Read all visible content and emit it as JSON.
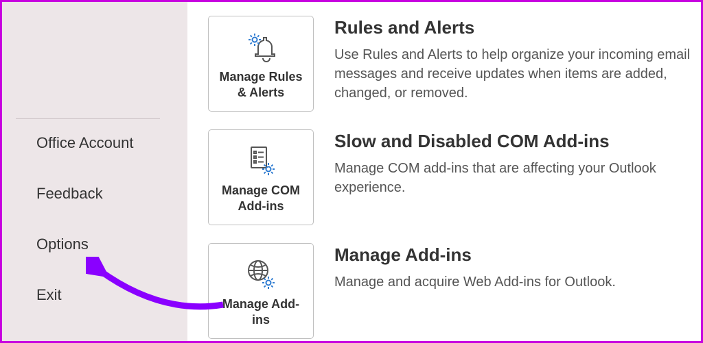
{
  "sidebar": {
    "items": [
      {
        "label": "Office Account"
      },
      {
        "label": "Feedback"
      },
      {
        "label": "Options"
      },
      {
        "label": "Exit"
      }
    ]
  },
  "main": {
    "rows": [
      {
        "tile_label": "Manage Rules & Alerts",
        "title": "Rules and Alerts",
        "text": "Use Rules and Alerts to help organize your incoming email messages and receive updates when items are added, changed, or removed."
      },
      {
        "tile_label": "Manage COM Add-ins",
        "title": "Slow and Disabled COM Add-ins",
        "text": "Manage COM add-ins that are affecting your Outlook experience."
      },
      {
        "tile_label": "Manage Add-ins",
        "title": "Manage Add-ins",
        "text": "Manage and acquire Web Add-ins for Outlook."
      }
    ]
  },
  "colors": {
    "accent": "#2e7bd1",
    "annotation": "#8a00ff"
  }
}
